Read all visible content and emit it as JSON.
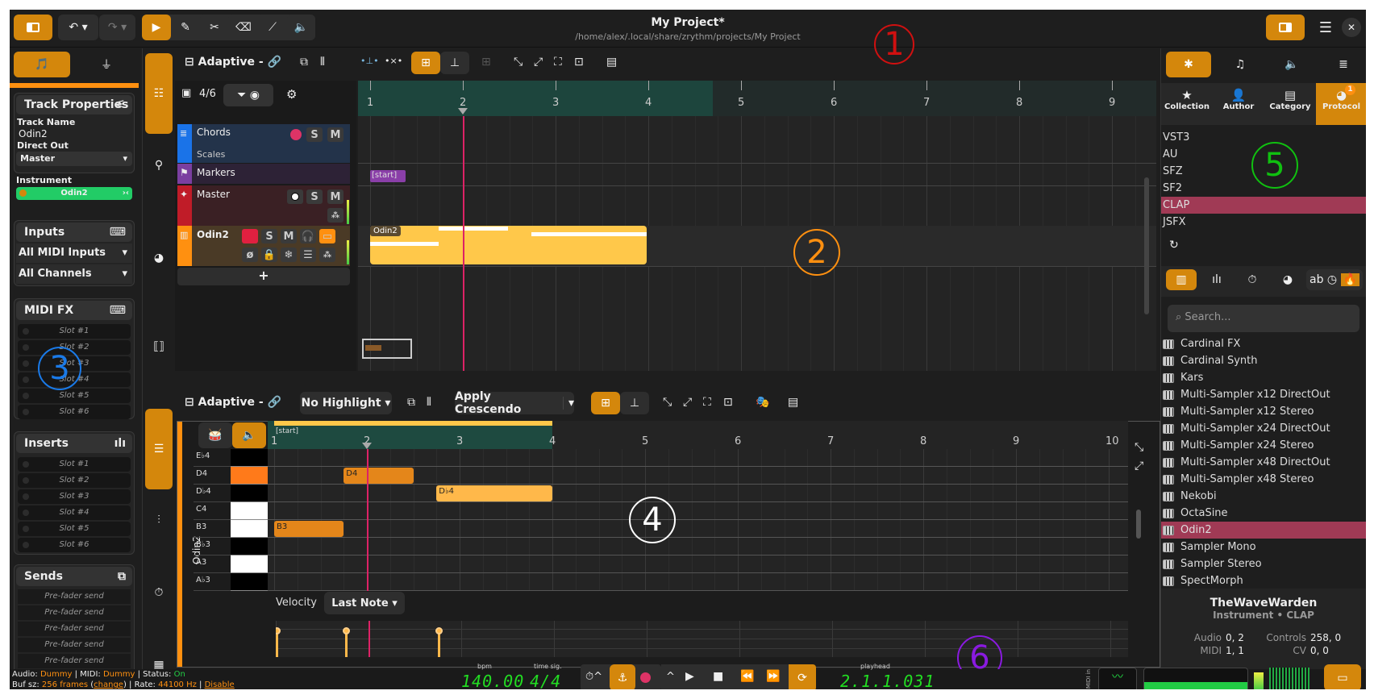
{
  "header": {
    "title": "My Project*",
    "subtitle": "/home/alex/.local/share/zrythm/projects/My Project"
  },
  "annotations": [
    "1",
    "2",
    "3",
    "4",
    "5",
    "6"
  ],
  "left_panel": {
    "track_properties": {
      "title": "Track Properties",
      "track_name_label": "Track Name",
      "track_name": "Odin2",
      "direct_out_label": "Direct Out",
      "direct_out": "Master",
      "instrument_label": "Instrument",
      "instrument": "Odin2"
    },
    "inputs": {
      "title": "Inputs",
      "midi_inputs": "All MIDI Inputs",
      "channels": "All Channels"
    },
    "midi_fx": {
      "title": "MIDI FX",
      "slots": [
        "Slot #1",
        "Slot #2",
        "Slot #3",
        "Slot #4",
        "Slot #5",
        "Slot #6"
      ]
    },
    "inserts": {
      "title": "Inserts",
      "slots": [
        "Slot #1",
        "Slot #2",
        "Slot #3",
        "Slot #4",
        "Slot #5",
        "Slot #6"
      ]
    },
    "sends": {
      "title": "Sends",
      "slots": [
        "Pre-fader send",
        "Pre-fader send",
        "Pre-fader send",
        "Pre-fader send",
        "Pre-fader send"
      ]
    }
  },
  "timeline": {
    "toolbar": {
      "snap_label": "Adaptive -"
    },
    "track_count": "4/6",
    "tracks": [
      {
        "name": "Chords",
        "sub": "Scales",
        "color": "#1a73e8"
      },
      {
        "name": "Markers",
        "color": "#7b3fa0"
      },
      {
        "name": "Master",
        "color": "#c01c28"
      },
      {
        "name": "Odin2",
        "color": "#ff9010"
      }
    ],
    "track_buttons": {
      "solo": "S",
      "mute": "M",
      "phase": "ø",
      "add": "+"
    },
    "ruler": [
      "1",
      "2",
      "3",
      "4",
      "5",
      "6",
      "7",
      "8",
      "9"
    ],
    "marker": "[start]",
    "region_name": "Odin2"
  },
  "editor": {
    "toolbar": {
      "snap_label": "Adaptive -",
      "highlight": "No Highlight",
      "function": "Apply Crescendo"
    },
    "track_label": "Odin2",
    "ruler": [
      "1",
      "2",
      "3",
      "4",
      "5",
      "6",
      "7",
      "8",
      "9",
      "10"
    ],
    "marker": "[start]",
    "keys": [
      "E♭4",
      "D4",
      "D♭4",
      "C4",
      "B3",
      "B♭3",
      "A3",
      "A♭3"
    ],
    "notes": [
      {
        "label": "D4",
        "start_bar": 1.75,
        "end_bar": 2.5,
        "key_index": 1
      },
      {
        "label": "D♭4",
        "start_bar": 2.75,
        "end_bar": 4.0,
        "key_index": 2
      },
      {
        "label": "B3",
        "start_bar": 1.0,
        "end_bar": 1.75,
        "key_index": 4
      }
    ],
    "velocity_label": "Velocity",
    "velocity_mode": "Last Note"
  },
  "right_panel": {
    "tabs": [
      "Collection",
      "Author",
      "Category",
      "Protocol"
    ],
    "protocol_badge": "1",
    "protocols": [
      "VST3",
      "AU",
      "SFZ",
      "SF2",
      "CLAP",
      "JSFX"
    ],
    "selected_protocol": "CLAP",
    "search_placeholder": "Search...",
    "filter_text_toggle": "ab",
    "plugins": [
      "Cardinal FX",
      "Cardinal Synth",
      "Kars",
      "Multi-Sampler x12 DirectOut",
      "Multi-Sampler x12 Stereo",
      "Multi-Sampler x24 DirectOut",
      "Multi-Sampler x24 Stereo",
      "Multi-Sampler x48 DirectOut",
      "Multi-Sampler x48 Stereo",
      "Nekobi",
      "OctaSine",
      "Odin2",
      "Sampler Mono",
      "Sampler Stereo",
      "SpectMorph"
    ],
    "selected_plugin": "Odin2",
    "info": {
      "author": "TheWaveWarden",
      "type": "Instrument • CLAP",
      "audio_label": "Audio",
      "audio": "0, 2",
      "midi_label": "MIDI",
      "midi": "1, 1",
      "controls_label": "Controls",
      "controls": "258, 0",
      "cv_label": "CV",
      "cv": "0, 0"
    }
  },
  "status": {
    "audio_label": "Audio:",
    "audio": "Dummy",
    "midi_label": "MIDI:",
    "midi": "Dummy",
    "status_label": "Status:",
    "status": "On",
    "buf_label": "Buf sz:",
    "buf": "256 frames",
    "change": "change",
    "rate_label": "Rate:",
    "rate": "44100 Hz",
    "disable": "Disable"
  },
  "transport": {
    "bpm_label": "bpm",
    "bpm": "140.00",
    "timesig_label": "time sig.",
    "timesig": "4/4",
    "playhead_label": "playhead",
    "playhead": "2.1.1.031",
    "midi_label": "MIDI in"
  }
}
